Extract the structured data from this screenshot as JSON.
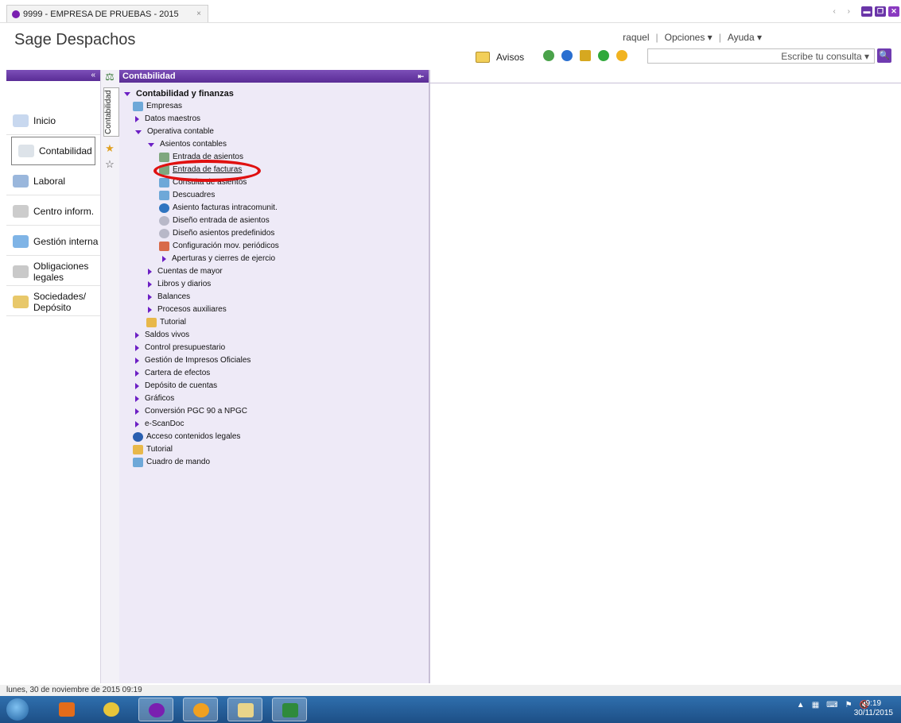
{
  "tab": {
    "title": "9999 - EMPRESA DE PRUEBAS - 2015",
    "close": "×"
  },
  "window": {
    "nav_arrows": "‹ ›",
    "min": "▬",
    "max": "❐",
    "close": "✕"
  },
  "header": {
    "app_name": "Sage Despachos",
    "user": "raquel",
    "options": "Opciones ▾",
    "help": "Ayuda ▾",
    "avisos": "Avisos",
    "search_placeholder": "Escribe tu consulta ▾"
  },
  "leftnav": {
    "collapse": "«",
    "items": [
      {
        "label": "Inicio"
      },
      {
        "label": "Contabilidad"
      },
      {
        "label": "Laboral"
      },
      {
        "label": "Centro inform."
      },
      {
        "label": "Gestión interna"
      },
      {
        "label": "Obligaciones legales"
      },
      {
        "label": "Sociedades/ Depósito"
      }
    ]
  },
  "vtabs": {
    "label": "Contabilidad"
  },
  "tree": {
    "header": "Contabilidad",
    "pin": "⇤",
    "items": [
      {
        "label": "Contabilidad y finanzas"
      },
      {
        "label": "Empresas"
      },
      {
        "label": "Datos maestros"
      },
      {
        "label": "Operativa contable"
      },
      {
        "label": "Asientos contables"
      },
      {
        "label": "Entrada de asientos"
      },
      {
        "label": "Entrada de facturas"
      },
      {
        "label": "Consulta de asientos"
      },
      {
        "label": "Descuadres"
      },
      {
        "label": "Asiento facturas intracomunit."
      },
      {
        "label": "Diseño entrada de asientos"
      },
      {
        "label": "Diseño asientos predefinidos"
      },
      {
        "label": "Configuración mov. periódicos"
      },
      {
        "label": "Aperturas y cierres de ejercio"
      },
      {
        "label": "Cuentas de mayor"
      },
      {
        "label": "Libros y diarios"
      },
      {
        "label": "Balances"
      },
      {
        "label": "Procesos auxiliares"
      },
      {
        "label": "Tutorial"
      },
      {
        "label": "Saldos vivos"
      },
      {
        "label": "Control presupuestario"
      },
      {
        "label": "Gestión de Impresos Oficiales"
      },
      {
        "label": "Cartera de efectos"
      },
      {
        "label": "Depósito de cuentas"
      },
      {
        "label": "Gráficos"
      },
      {
        "label": "Conversión PGC 90 a NPGC"
      },
      {
        "label": "e-ScanDoc"
      },
      {
        "label": "Acceso contenidos legales"
      },
      {
        "label": "Tutorial"
      },
      {
        "label": "Cuadro de mando"
      }
    ]
  },
  "status": {
    "text": "lunes, 30 de noviembre de 2015  09:19"
  },
  "taskbar": {
    "time": "9:19",
    "date": "30/11/2015"
  }
}
